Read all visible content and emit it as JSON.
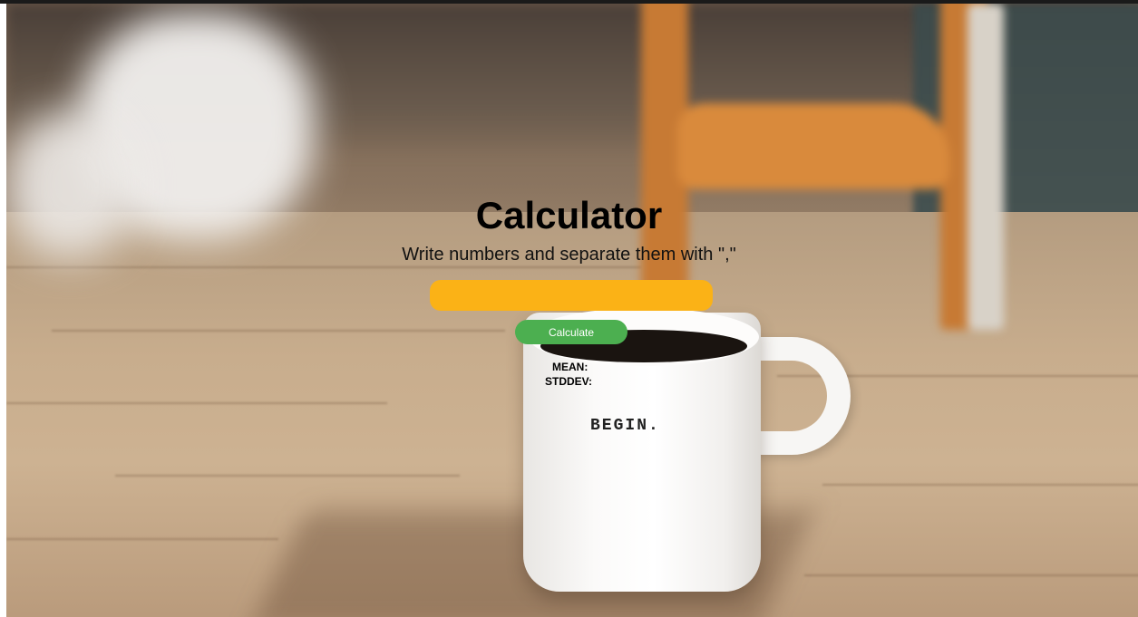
{
  "page": {
    "title": "Calculator",
    "subtitle": "Write numbers and separate them with \",\"",
    "input": {
      "value": "",
      "placeholder": ""
    },
    "calculate_label": "Calculate",
    "results": {
      "mean_label": "MEAN:",
      "mean_value": "",
      "stddev_label": "STDDEV:",
      "stddev_value": ""
    }
  },
  "background": {
    "mug_text": "BEGIN."
  },
  "colors": {
    "input_background": "#fbb216",
    "button_background": "#4caf50",
    "button_text": "#ffffff",
    "title_text": "#000000"
  }
}
